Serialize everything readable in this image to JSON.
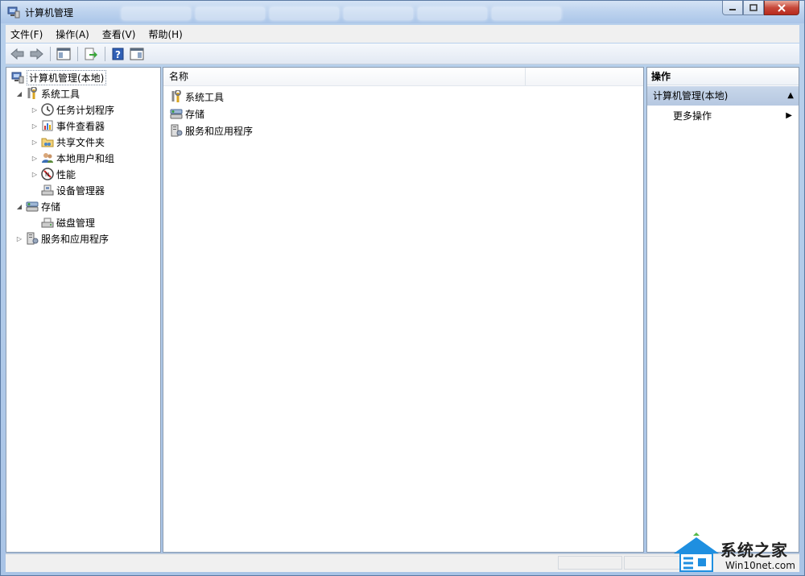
{
  "window": {
    "title": "计算机管理"
  },
  "menu": [
    "文件(F)",
    "操作(A)",
    "查看(V)",
    "帮助(H)"
  ],
  "tree": {
    "root": "计算机管理(本地)",
    "items": [
      {
        "label": "系统工具",
        "level": 1,
        "twisty": "expanded",
        "icon": "tools-icon"
      },
      {
        "label": "任务计划程序",
        "level": 2,
        "twisty": "collapsed",
        "icon": "clock-icon"
      },
      {
        "label": "事件查看器",
        "level": 2,
        "twisty": "collapsed",
        "icon": "event-viewer-icon"
      },
      {
        "label": "共享文件夹",
        "level": 2,
        "twisty": "collapsed",
        "icon": "shared-folder-icon"
      },
      {
        "label": "本地用户和组",
        "level": 2,
        "twisty": "collapsed",
        "icon": "users-icon"
      },
      {
        "label": "性能",
        "level": 2,
        "twisty": "collapsed",
        "icon": "performance-icon"
      },
      {
        "label": "设备管理器",
        "level": 2,
        "twisty": "none",
        "icon": "device-manager-icon"
      },
      {
        "label": "存储",
        "level": 1,
        "twisty": "expanded",
        "icon": "storage-icon"
      },
      {
        "label": "磁盘管理",
        "level": 2,
        "twisty": "none",
        "icon": "disk-icon"
      },
      {
        "label": "服务和应用程序",
        "level": 1,
        "twisty": "collapsed",
        "icon": "services-icon"
      }
    ]
  },
  "list": {
    "column_name": "名称",
    "items": [
      {
        "label": "系统工具",
        "icon": "tools-icon"
      },
      {
        "label": "存储",
        "icon": "storage-icon"
      },
      {
        "label": "服务和应用程序",
        "icon": "services-icon"
      }
    ]
  },
  "actions": {
    "header": "操作",
    "section": "计算机管理(本地)",
    "more": "更多操作"
  },
  "watermark": {
    "title": "系统之家",
    "url": "Win10net.com"
  }
}
